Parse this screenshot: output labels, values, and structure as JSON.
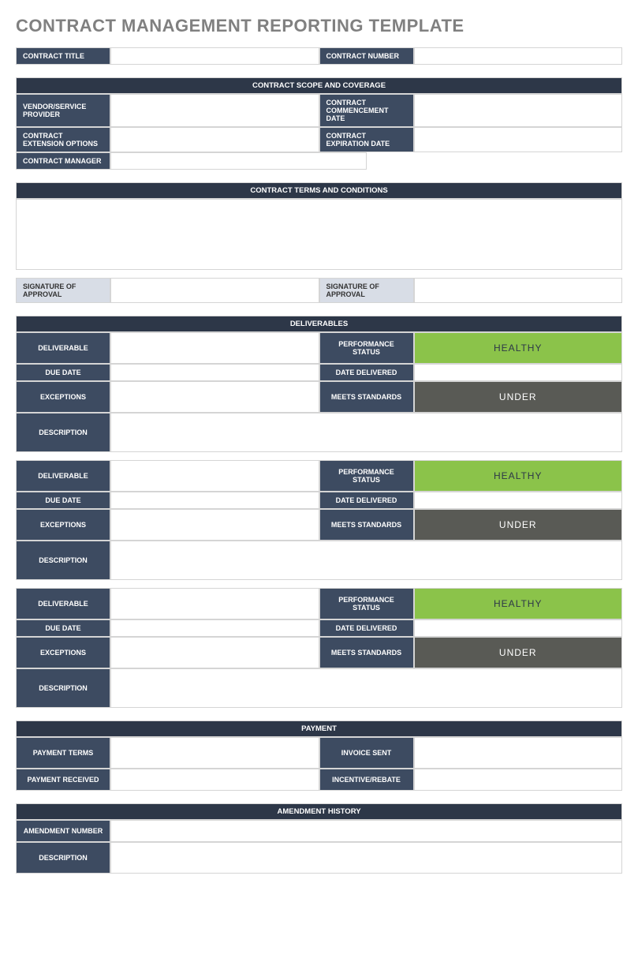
{
  "title": "CONTRACT MANAGEMENT REPORTING TEMPLATE",
  "top": {
    "contract_title": "CONTRACT TITLE",
    "contract_number": "CONTRACT NUMBER"
  },
  "scope": {
    "header": "CONTRACT SCOPE AND COVERAGE",
    "vendor": "VENDOR/SERVICE PROVIDER",
    "commencement": "CONTRACT COMMENCEMENT DATE",
    "extension": "CONTRACT EXTENSION OPTIONS",
    "expiration": "CONTRACT EXPIRATION DATE",
    "manager": "CONTRACT MANAGER"
  },
  "terms": {
    "header": "CONTRACT TERMS AND CONDITIONS",
    "sig1": "SIGNATURE OF APPROVAL",
    "sig2": "SIGNATURE OF APPROVAL"
  },
  "deliverables": {
    "header": "DELIVERABLES",
    "labels": {
      "deliverable": "DELIVERABLE",
      "perf": "PERFORMANCE STATUS",
      "due": "DUE DATE",
      "delivered": "DATE DELIVERED",
      "exceptions": "EXCEPTIONS",
      "meets": "MEETS STANDARDS",
      "description": "DESCRIPTION"
    },
    "items": [
      {
        "perf_status": "HEALTHY",
        "meets_status": "UNDER"
      },
      {
        "perf_status": "HEALTHY",
        "meets_status": "UNDER"
      },
      {
        "perf_status": "HEALTHY",
        "meets_status": "UNDER"
      }
    ]
  },
  "payment": {
    "header": "PAYMENT",
    "terms": "PAYMENT TERMS",
    "invoice": "INVOICE SENT",
    "received": "PAYMENT RECEIVED",
    "incentive": "INCENTIVE/REBATE"
  },
  "amendment": {
    "header": "AMENDMENT HISTORY",
    "number": "AMENDMENT NUMBER",
    "description": "DESCRIPTION"
  }
}
